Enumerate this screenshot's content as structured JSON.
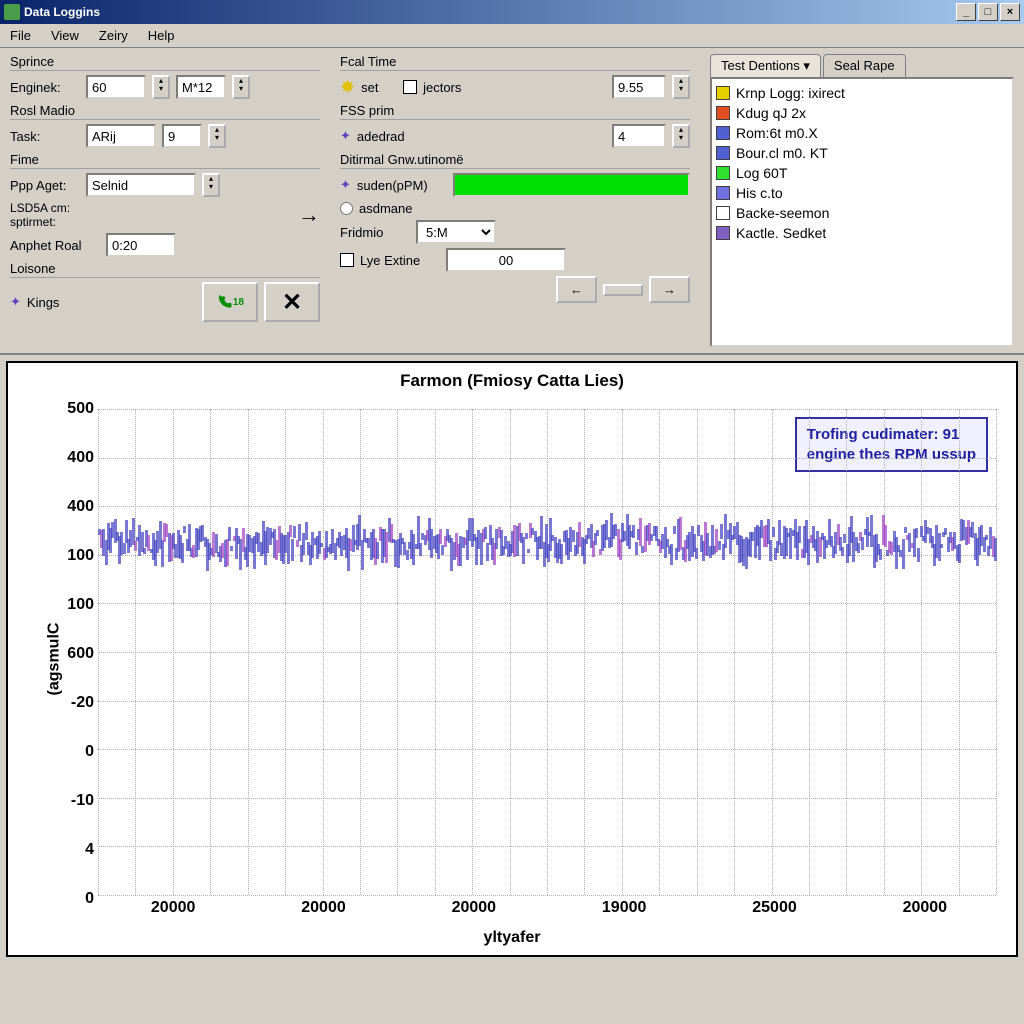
{
  "window": {
    "title": "Data Loggins"
  },
  "menu": {
    "file": "File",
    "view": "View",
    "zeiry": "Zeiry",
    "help": "Help"
  },
  "left": {
    "sprince": "Sprince",
    "enginek_label": "Enginek:",
    "enginek_value": "60",
    "enginek_unit": "M*12",
    "rosl_madio": "Rosl Madio",
    "task_label": "Task:",
    "task_value": "ARij",
    "task_num": "9",
    "fime": "Fime",
    "ppp_label": "Ppp Aget:",
    "ppp_value": "Selnid",
    "lsd_label": "LSD5A cm:",
    "spt_label": "sptirmet:",
    "anphet_label": "Anphet Roal",
    "anphet_value": "0:20",
    "loisone": "Loisone",
    "kings": "Kings",
    "kings_btn": "18"
  },
  "mid": {
    "fcal_time": "Fcal Time",
    "set": "set",
    "jectors": "jectors",
    "jectors_val": "9.55",
    "fss_prim": "FSS prim",
    "adedrad": "adedrad",
    "adedrad_val": "4",
    "ditirmal": "Ditirmal Gnw.utinomё",
    "suden": "suden(pPM)",
    "asdmane": "asdmane",
    "fridmio": "Fridmio",
    "fridmio_val": "5:M",
    "lye": "Lye Extine",
    "lye_val": "00"
  },
  "right": {
    "tab1": "Test Dentions",
    "tab2": "Seal Rape",
    "items": [
      {
        "color": "#e8d000",
        "label": "Krnp Logg: ixirect"
      },
      {
        "color": "#e05020",
        "label": "Kdug qJ 2x"
      },
      {
        "color": "#5060d0",
        "label": "Rom:6t m0.X"
      },
      {
        "color": "#5060d0",
        "label": "Bour.cl m0. KT"
      },
      {
        "color": "#30e030",
        "label": "Log 60T"
      },
      {
        "color": "#7070e0",
        "label": "His c.to"
      },
      {
        "color": "#ffffff",
        "label": "Backe-seemon"
      },
      {
        "color": "#8060c0",
        "label": "Kactle. Sedket"
      }
    ]
  },
  "chart_data": {
    "type": "scatter",
    "title": "Farmon (Fmiosy Catta Lies)",
    "xlabel": "yltyafer",
    "ylabel": "(agsmulC",
    "y_ticks": [
      500,
      400,
      400,
      100,
      100,
      600,
      -20,
      0,
      -10,
      4,
      0
    ],
    "x_ticks": [
      20000,
      20000,
      20000,
      19000,
      25000,
      20000
    ],
    "legend": [
      "Trofing cudimater: 91",
      "engine thes RPM ussup"
    ],
    "data_band_y": 100,
    "ylim": [
      0,
      500
    ],
    "series_count": 1,
    "approx_points": 400
  }
}
